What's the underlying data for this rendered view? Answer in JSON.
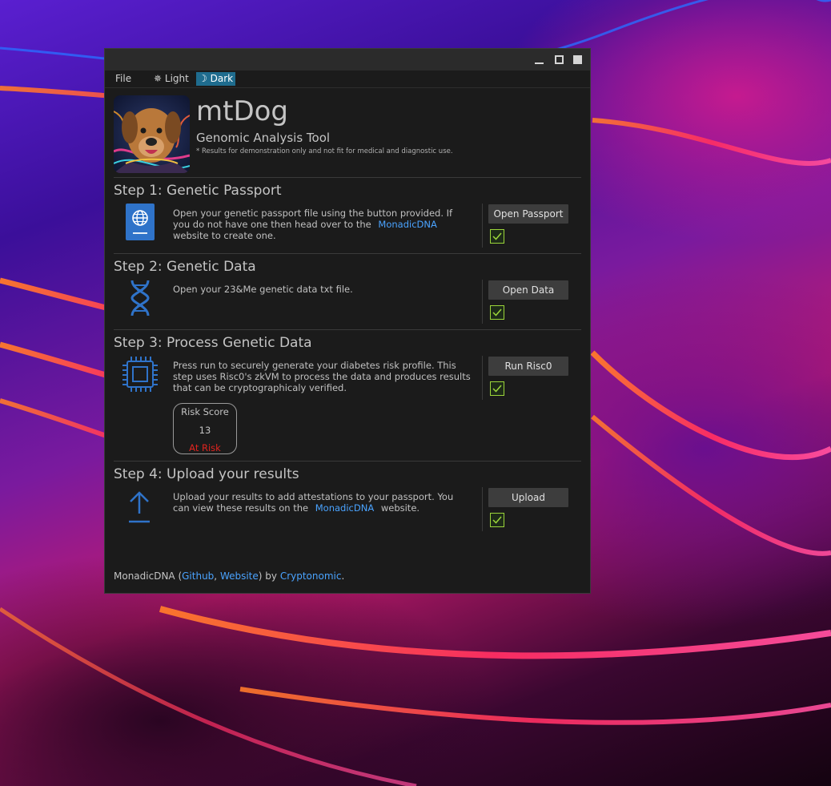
{
  "window": {
    "controls": {
      "minimize": "minimize-icon",
      "maximize": "maximize-icon",
      "close": "close-icon"
    }
  },
  "menu": {
    "file": "File",
    "light": "Light",
    "dark": "Dark",
    "light_icon": "sun-icon",
    "dark_icon": "moon-icon"
  },
  "header": {
    "title": "mtDog",
    "subtitle": "Genomic Analysis Tool",
    "disclaimer": "* Results for demonstration only and not fit for medical and diagnostic use."
  },
  "steps": [
    {
      "title": "Step 1: Genetic Passport",
      "icon": "passport-icon",
      "text_before": "Open your genetic passport file using the button provided. If you do not have one then head over to the",
      "link": "MonadicDNA",
      "text_after": "website to create one.",
      "button": "Open Passport",
      "checked": true
    },
    {
      "title": "Step 2: Genetic Data",
      "icon": "dna-icon",
      "text": "Open your 23&Me genetic data txt file.",
      "button": "Open Data",
      "checked": true
    },
    {
      "title": "Step 3: Process Genetic Data",
      "icon": "chip-icon",
      "text": "Press run to securely generate your diabetes risk profile. This step uses Risc0's zkVM to process the data and produces results that can be cryptographicaly verified.",
      "button": "Run Risc0",
      "checked": true,
      "risk": {
        "label": "Risk Score",
        "value": "13",
        "status": "At Risk"
      }
    },
    {
      "title": "Step 4: Upload your results",
      "icon": "upload-icon",
      "text_before": "Upload your results to add attestations to your passport. You can view these results on the",
      "link": "MonadicDNA",
      "text_after": "website.",
      "button": "Upload",
      "checked": true
    }
  ],
  "footer": {
    "prefix": "MonadicDNA (",
    "github": "Github",
    "sep": ", ",
    "website": "Website",
    "mid": ") by ",
    "org": "Cryptonomic",
    "suffix": "."
  },
  "colors": {
    "accent": "#4aa3ff",
    "check": "#9bd53a",
    "risk": "#e0241f",
    "dark_tab": "#1f6c8e",
    "icon_blue": "#2f73c9"
  }
}
